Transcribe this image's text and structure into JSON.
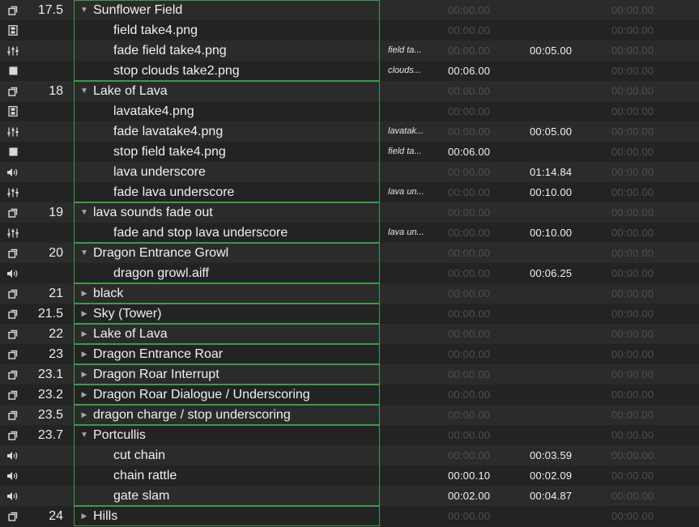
{
  "cue_list": {
    "rows": [
      {
        "type": "group",
        "icon": "group-icon",
        "number": "17.5",
        "name": "Sunflower Field",
        "expanded": true,
        "target": "",
        "prewait": "00:00.00",
        "action": "",
        "postwait": "00:00.00"
      },
      {
        "type": "video",
        "icon": "video-icon",
        "number": "",
        "name": "field take4.png",
        "target": "",
        "prewait": "00:00.00",
        "action": "",
        "postwait": "00:00.00"
      },
      {
        "type": "fade",
        "icon": "fade-icon",
        "number": "",
        "name": "fade field take4.png",
        "target": "field ta...",
        "prewait": "00:00.00",
        "action": "00:05.00",
        "postwait": "00:00.00"
      },
      {
        "type": "stop",
        "icon": "stop-icon",
        "number": "",
        "name": "stop clouds take2.png",
        "target": "clouds...",
        "prewait": "00:06.00",
        "action": "",
        "postwait": "00:00.00"
      },
      {
        "type": "group",
        "icon": "group-icon",
        "number": "18",
        "name": "Lake of Lava",
        "expanded": true,
        "target": "",
        "prewait": "00:00.00",
        "action": "",
        "postwait": "00:00.00"
      },
      {
        "type": "video",
        "icon": "video-icon",
        "number": "",
        "name": "lavatake4.png",
        "target": "",
        "prewait": "00:00.00",
        "action": "",
        "postwait": "00:00.00"
      },
      {
        "type": "fade",
        "icon": "fade-icon",
        "number": "",
        "name": "fade lavatake4.png",
        "target": "lavatak...",
        "prewait": "00:00.00",
        "action": "00:05.00",
        "postwait": "00:00.00"
      },
      {
        "type": "stop",
        "icon": "stop-icon",
        "number": "",
        "name": "stop field take4.png",
        "target": "field ta...",
        "prewait": "00:06.00",
        "action": "",
        "postwait": "00:00.00"
      },
      {
        "type": "audio",
        "icon": "speaker-icon",
        "number": "",
        "name": "lava underscore",
        "target": "",
        "prewait": "00:00.00",
        "action": "01:14.84",
        "postwait": "00:00.00"
      },
      {
        "type": "fade",
        "icon": "fade-icon",
        "number": "",
        "name": "fade lava underscore",
        "target": "lava un...",
        "prewait": "00:00.00",
        "action": "00:10.00",
        "postwait": "00:00.00"
      },
      {
        "type": "group",
        "icon": "group-icon",
        "number": "19",
        "name": "lava sounds fade out",
        "expanded": true,
        "target": "",
        "prewait": "00:00.00",
        "action": "",
        "postwait": "00:00.00"
      },
      {
        "type": "fade",
        "icon": "fade-icon",
        "number": "",
        "name": "fade and stop lava underscore",
        "target": "lava un...",
        "prewait": "00:00.00",
        "action": "00:10.00",
        "postwait": "00:00.00"
      },
      {
        "type": "group",
        "icon": "group-icon",
        "number": "20",
        "name": "Dragon Entrance Growl",
        "expanded": true,
        "target": "",
        "prewait": "00:00.00",
        "action": "",
        "postwait": "00:00.00"
      },
      {
        "type": "audio",
        "icon": "speaker-icon",
        "number": "",
        "name": "dragon growl.aiff",
        "target": "",
        "prewait": "00:00.00",
        "action": "00:06.25",
        "postwait": "00:00.00"
      },
      {
        "type": "group",
        "icon": "group-icon",
        "number": "21",
        "name": "black",
        "expanded": false,
        "target": "",
        "prewait": "00:00.00",
        "action": "",
        "postwait": "00:00.00"
      },
      {
        "type": "group",
        "icon": "group-icon",
        "number": "21.5",
        "name": "Sky (Tower)",
        "expanded": false,
        "target": "",
        "prewait": "00:00.00",
        "action": "",
        "postwait": "00:00.00"
      },
      {
        "type": "group",
        "icon": "group-icon",
        "number": "22",
        "name": "Lake of Lava",
        "expanded": false,
        "target": "",
        "prewait": "00:00.00",
        "action": "",
        "postwait": "00:00.00"
      },
      {
        "type": "group",
        "icon": "group-icon",
        "number": "23",
        "name": "Dragon Entrance Roar",
        "expanded": false,
        "target": "",
        "prewait": "00:00.00",
        "action": "",
        "postwait": "00:00.00"
      },
      {
        "type": "group",
        "icon": "group-icon",
        "number": "23.1",
        "name": "Dragon Roar Interrupt",
        "expanded": false,
        "target": "",
        "prewait": "00:00.00",
        "action": "",
        "postwait": "00:00.00"
      },
      {
        "type": "group",
        "icon": "group-icon",
        "number": "23.2",
        "name": "Dragon Roar Dialogue / Underscoring",
        "expanded": false,
        "target": "",
        "prewait": "00:00.00",
        "action": "",
        "postwait": "00:00.00"
      },
      {
        "type": "group",
        "icon": "group-icon",
        "number": "23.5",
        "name": "dragon charge / stop underscoring",
        "expanded": false,
        "target": "",
        "prewait": "00:00.00",
        "action": "",
        "postwait": "00:00.00"
      },
      {
        "type": "group",
        "icon": "group-icon",
        "number": "23.7",
        "name": "Portcullis",
        "expanded": true,
        "target": "",
        "prewait": "00:00.00",
        "action": "",
        "postwait": "00:00.00"
      },
      {
        "type": "audio",
        "icon": "speaker-icon",
        "number": "",
        "name": "cut chain",
        "target": "",
        "prewait": "00:00.00",
        "action": "00:03.59",
        "postwait": "00:00.00"
      },
      {
        "type": "audio",
        "icon": "speaker-icon",
        "number": "",
        "name": "chain rattle",
        "target": "",
        "prewait": "00:00.10",
        "action": "00:02.09",
        "postwait": "00:00.00"
      },
      {
        "type": "audio",
        "icon": "speaker-icon",
        "number": "",
        "name": "gate slam",
        "target": "",
        "prewait": "00:02.00",
        "action": "00:04.87",
        "postwait": "00:00.00"
      },
      {
        "type": "group",
        "icon": "group-icon",
        "number": "24",
        "name": "Hills",
        "expanded": false,
        "target": "",
        "prewait": "00:00.00",
        "action": "",
        "postwait": "00:00.00"
      }
    ],
    "colors": {
      "group_border": "#3c9a4a",
      "row_even": "#2b2b2b",
      "row_odd": "#232323",
      "text": "#f0f0f0",
      "dim_time": "#4e4e4e",
      "disclosure": "#a8a8a8"
    }
  }
}
